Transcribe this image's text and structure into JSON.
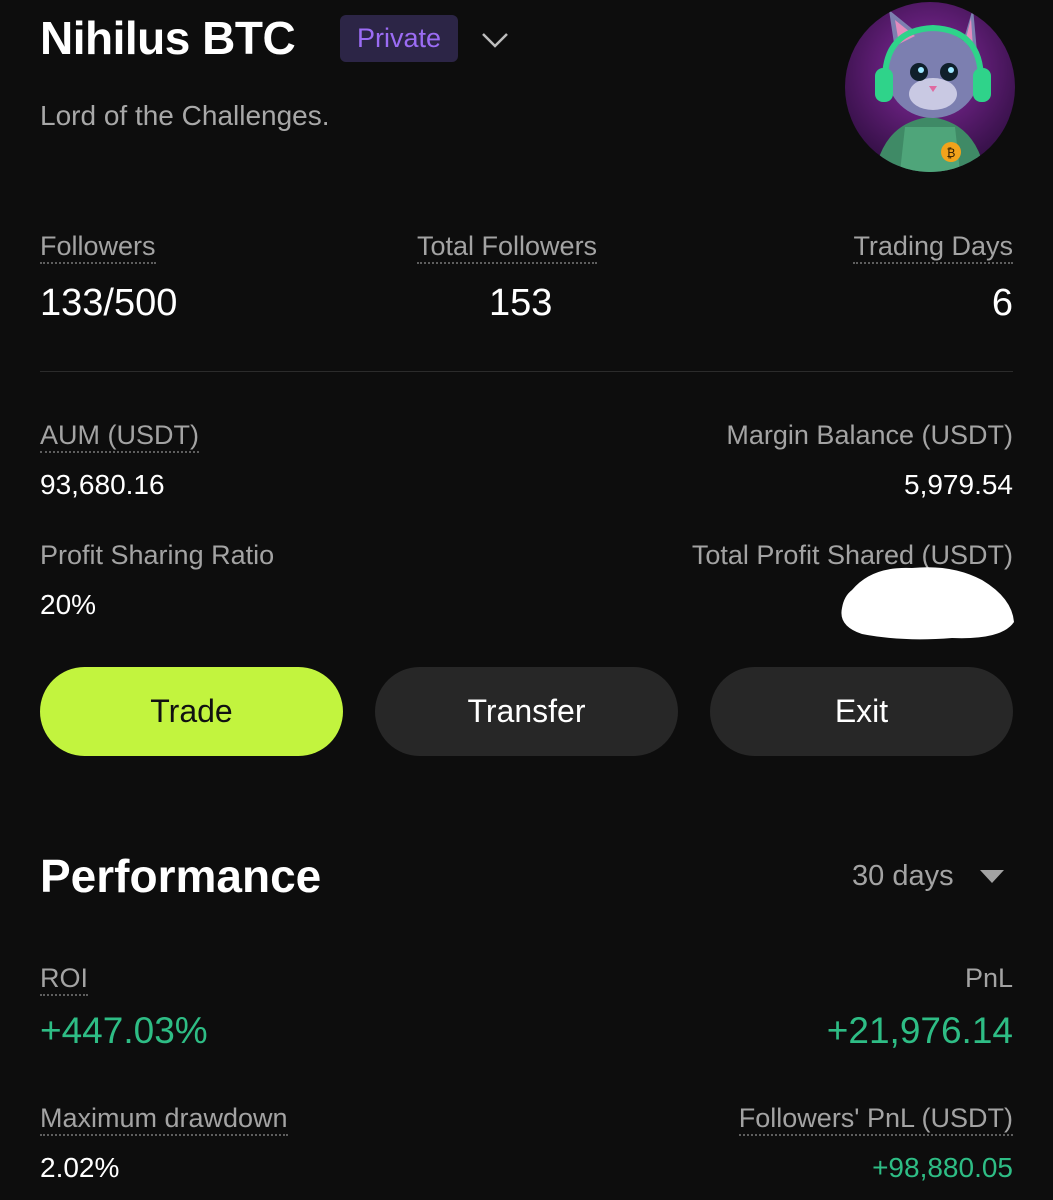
{
  "header": {
    "title": "Nihilus BTC",
    "badge": "Private",
    "subtitle": "Lord of the Challenges."
  },
  "stats": {
    "followers_label": "Followers",
    "followers_value": "133/500",
    "total_followers_label": "Total Followers",
    "total_followers_value": "153",
    "trading_days_label": "Trading Days",
    "trading_days_value": "6"
  },
  "balances": {
    "aum_label": "AUM (USDT)",
    "aum_value": "93,680.16",
    "margin_label": "Margin Balance (USDT)",
    "margin_value": "5,979.54",
    "profit_ratio_label": "Profit Sharing Ratio",
    "profit_ratio_value": "20%",
    "total_profit_label": "Total Profit Shared (USDT)"
  },
  "actions": {
    "trade": "Trade",
    "transfer": "Transfer",
    "exit": "Exit"
  },
  "performance": {
    "title": "Performance",
    "range": "30 days",
    "roi_label": "ROI",
    "roi_value": "+447.03%",
    "pnl_label": "PnL",
    "pnl_value": "+21,976.14",
    "drawdown_label": "Maximum drawdown",
    "drawdown_value": "2.02%",
    "followers_pnl_label": "Followers' PnL (USDT)",
    "followers_pnl_value": "+98,880.05"
  },
  "colors": {
    "background": "#0d0d0d",
    "accent": "#c2f43e",
    "positive": "#2ebd85",
    "badge_text": "#9b6cf4"
  },
  "icons": {
    "dropdown": "chevron-down-icon",
    "range_dropdown": "caret-down-icon",
    "detail": "chevron-right-icon"
  }
}
